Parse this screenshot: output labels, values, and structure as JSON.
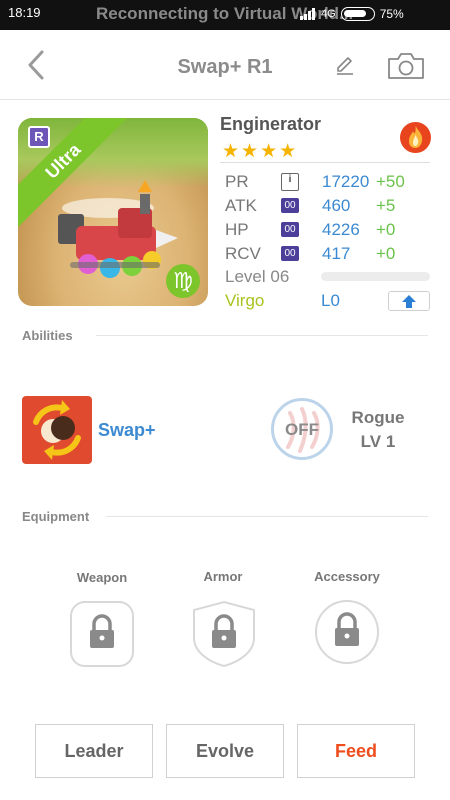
{
  "status_bar": {
    "time": "18:19",
    "notification": "Reconnecting to Virtual World...",
    "network": "4G",
    "battery_percent": "75%"
  },
  "header": {
    "title": "Swap+ R1"
  },
  "card": {
    "ribbon_text": "Ultra",
    "rarity_letter": "R",
    "zodiac_symbol": "♍",
    "name": "Enginerator",
    "star_count": 4,
    "element_icon": "fire-icon",
    "stats": [
      {
        "label": "PR",
        "icon": "i",
        "value": "17220",
        "bonus": "+50"
      },
      {
        "label": "ATK",
        "icon": "00",
        "value": "460",
        "bonus": "+5"
      },
      {
        "label": "HP",
        "icon": "00",
        "value": "4226",
        "bonus": "+0"
      },
      {
        "label": "RCV",
        "icon": "00",
        "value": "417",
        "bonus": "+0"
      }
    ],
    "level_text": "Level 06",
    "zodiac_name": "Virgo",
    "limit_level": "L0"
  },
  "abilities": {
    "section_title": "Abilities",
    "ability_name": "Swap+",
    "toggle_text": "OFF",
    "class_name": "Rogue",
    "class_level": "LV 1"
  },
  "equipment": {
    "section_title": "Equipment",
    "slots": [
      {
        "label": "Weapon"
      },
      {
        "label": "Armor"
      },
      {
        "label": "Accessory"
      }
    ]
  },
  "footer": {
    "leader_label": "Leader",
    "evolve_label": "Evolve",
    "feed_label": "Feed"
  },
  "colors": {
    "accent_blue": "#3c8ad1",
    "bonus_green": "#6cc34a",
    "feed_orange": "#ef4d1e",
    "star_yellow": "#f5b400"
  }
}
